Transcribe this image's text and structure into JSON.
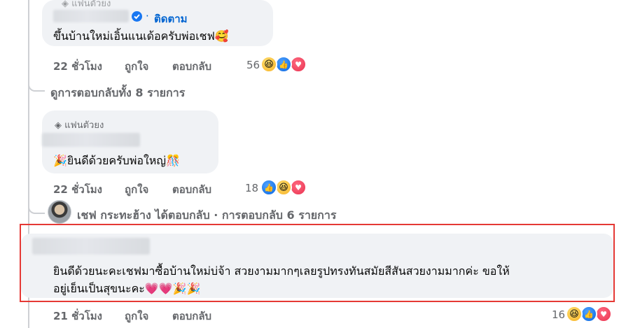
{
  "comment1": {
    "badge_label": "แฟนตัวยง",
    "separator": "·",
    "follow_label": "ติดตาม",
    "text": "ขึ้นบ้านใหม่เอิ้นแนเด้อครับพ่อเชฟ",
    "text_emoji": "🥰",
    "time": "22 ชั่วโมง",
    "like_label": "ถูกใจ",
    "reply_label": "ตอบกลับ",
    "reaction_count": "56"
  },
  "view_replies_1": "ดูการตอบกลับทั้ง 8 รายการ",
  "comment2": {
    "badge_label": "แฟนตัวยง",
    "lead_emoji": "🎉",
    "text": "ยินดีด้วยครับพ่อใหญ่",
    "text_emoji": "🎊",
    "time": "22 ชั่วโมง",
    "like_label": "ถูกใจ",
    "reply_label": "ตอบกลับ",
    "reaction_count": "18"
  },
  "reply_summary": {
    "author": "เชฟ กระทะฮ้าง",
    "action": "ได้ตอบกลับ",
    "separator": "·",
    "count_text": "การตอบกลับ 6 รายการ"
  },
  "comment3": {
    "line1": "ยินดีด้วยนะคะเชฟมาซื้อบ้านใหม่บ่จ้า สวยงามมากๆเลยรูปทรงทันสมัยสีสันสวยงามมากค่ะ ขอให้",
    "line2": "อยู่เย็นเป็นสุขนะคะ",
    "line2_emojis": "💗💗🎉🎉",
    "time": "21 ชั่วโมง",
    "like_label": "ถูกใจ",
    "reply_label": "ตอบกลับ",
    "reaction_count": "16"
  },
  "colors": {
    "highlight_border": "#e53935",
    "link_blue": "#0064d1",
    "secondary_text": "#65676b",
    "bubble_bg": "#f0f2f5"
  }
}
